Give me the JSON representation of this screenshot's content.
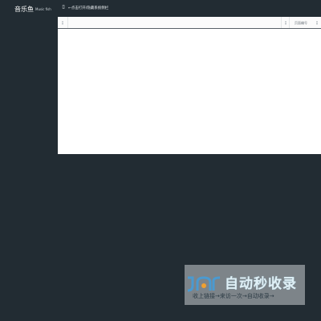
{
  "header": {
    "brand": "音乐鱼",
    "brand_sub": "Music fish",
    "menu_icon": "menu-toggle-icon",
    "hint": "←点击打开/隐藏系统侧栏"
  },
  "table": {
    "last_column_label": "页面编号",
    "sort_icon": "sort-icon"
  },
  "watermark": {
    "title": "自动秒收录",
    "subtitle": "收上链接→来访一次→自动收录→"
  },
  "colors": {
    "background": "#222c33",
    "panel": "#ffffff",
    "header_border": "#5a6168"
  }
}
